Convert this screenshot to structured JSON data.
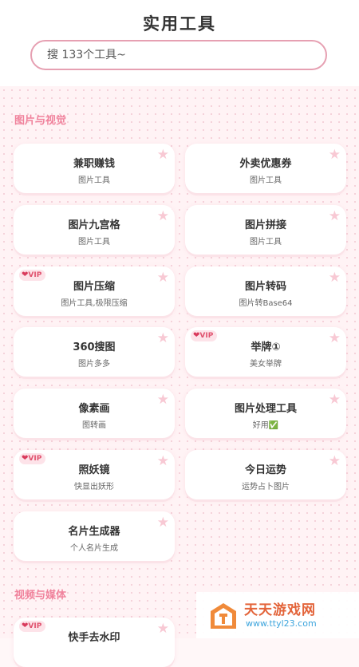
{
  "header": {
    "title": "实用工具"
  },
  "search": {
    "placeholder": "搜 133个工具~"
  },
  "sections": [
    {
      "title": "图片与视觉"
    },
    {
      "title": "视频与媒体"
    }
  ],
  "vip_label": "VIP",
  "tools": [
    {
      "name": "兼职赚钱",
      "desc": "图片工具",
      "vip": false
    },
    {
      "name": "外卖优惠券",
      "desc": "图片工具",
      "vip": false
    },
    {
      "name": "图片九宫格",
      "desc": "图片工具",
      "vip": false
    },
    {
      "name": "图片拼接",
      "desc": "图片工具",
      "vip": false
    },
    {
      "name": "图片压缩",
      "desc": "图片工具,极限压缩",
      "vip": true
    },
    {
      "name": "图片转码",
      "desc": "图片转Base64",
      "vip": false
    },
    {
      "name": "360搜图",
      "desc": "图片多多",
      "vip": false
    },
    {
      "name": "举牌①",
      "desc": "美女举牌",
      "vip": true
    },
    {
      "name": "像素画",
      "desc": "图转画",
      "vip": false
    },
    {
      "name": "图片处理工具",
      "desc": "好用✅",
      "vip": false
    },
    {
      "name": "照妖镜",
      "desc": "快显出妖形",
      "vip": true
    },
    {
      "name": "今日运势",
      "desc": "运势占卜图片",
      "vip": false
    },
    {
      "name": "名片生成器",
      "desc": "个人名片生成",
      "vip": false
    }
  ],
  "media_tools": [
    {
      "name": "快手去水印",
      "vip": true
    }
  ],
  "icons": {
    "favorite": "star-icon",
    "vip": "heart-icon",
    "logo": "house-logo-icon"
  },
  "colors": {
    "accent": "#f0829c",
    "star": "#f8c9d4",
    "search_border": "#e6a0b2"
  },
  "watermark": {
    "name": "天天游戏网",
    "url": "www.ttyl23.com"
  }
}
